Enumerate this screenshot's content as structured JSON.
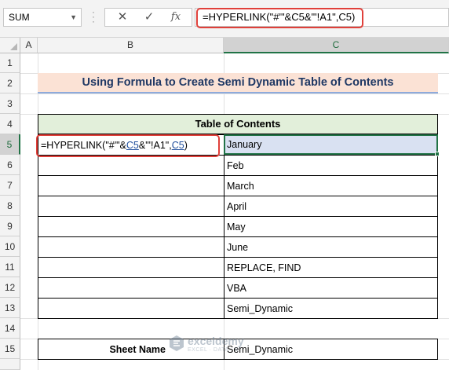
{
  "formula_bar": {
    "name_box": "SUM",
    "cancel_icon": "✕",
    "enter_icon": "✓",
    "fx_label": "fx",
    "formula": "=HYPERLINK(\"#'\"&C5&\"'!A1\",C5)"
  },
  "columns": [
    "A",
    "B",
    "C"
  ],
  "rows": [
    "1",
    "2",
    "3",
    "4",
    "5",
    "6",
    "7",
    "8",
    "9",
    "10",
    "11",
    "12",
    "13",
    "14",
    "15"
  ],
  "title": "Using Formula to Create Semi Dynamic Table of Contents",
  "toc": {
    "header": "Table of Contents",
    "edit_formula": {
      "p1": "=HYPERLINK(\"#'\"&",
      "ref1": "C5",
      "p2": "&\"'!A1\",",
      "ref2": "C5",
      "p3": ")"
    },
    "sheets": [
      "January",
      "Feb",
      "March",
      "April",
      "May",
      "June",
      "REPLACE, FIND",
      "VBA",
      "Semi_Dynamic"
    ]
  },
  "sheet_name": {
    "label": "Sheet Name",
    "value": "Semi_Dynamic"
  },
  "watermark": {
    "brand": "exceldemy",
    "tagline": "EXCEL · DATA · BI"
  },
  "colors": {
    "selection_green": "#217346",
    "highlight_red": "#e0403a",
    "title_fill": "#fbe2d5",
    "header_fill": "#e2efda",
    "selected_fill": "#d9e1f2"
  }
}
